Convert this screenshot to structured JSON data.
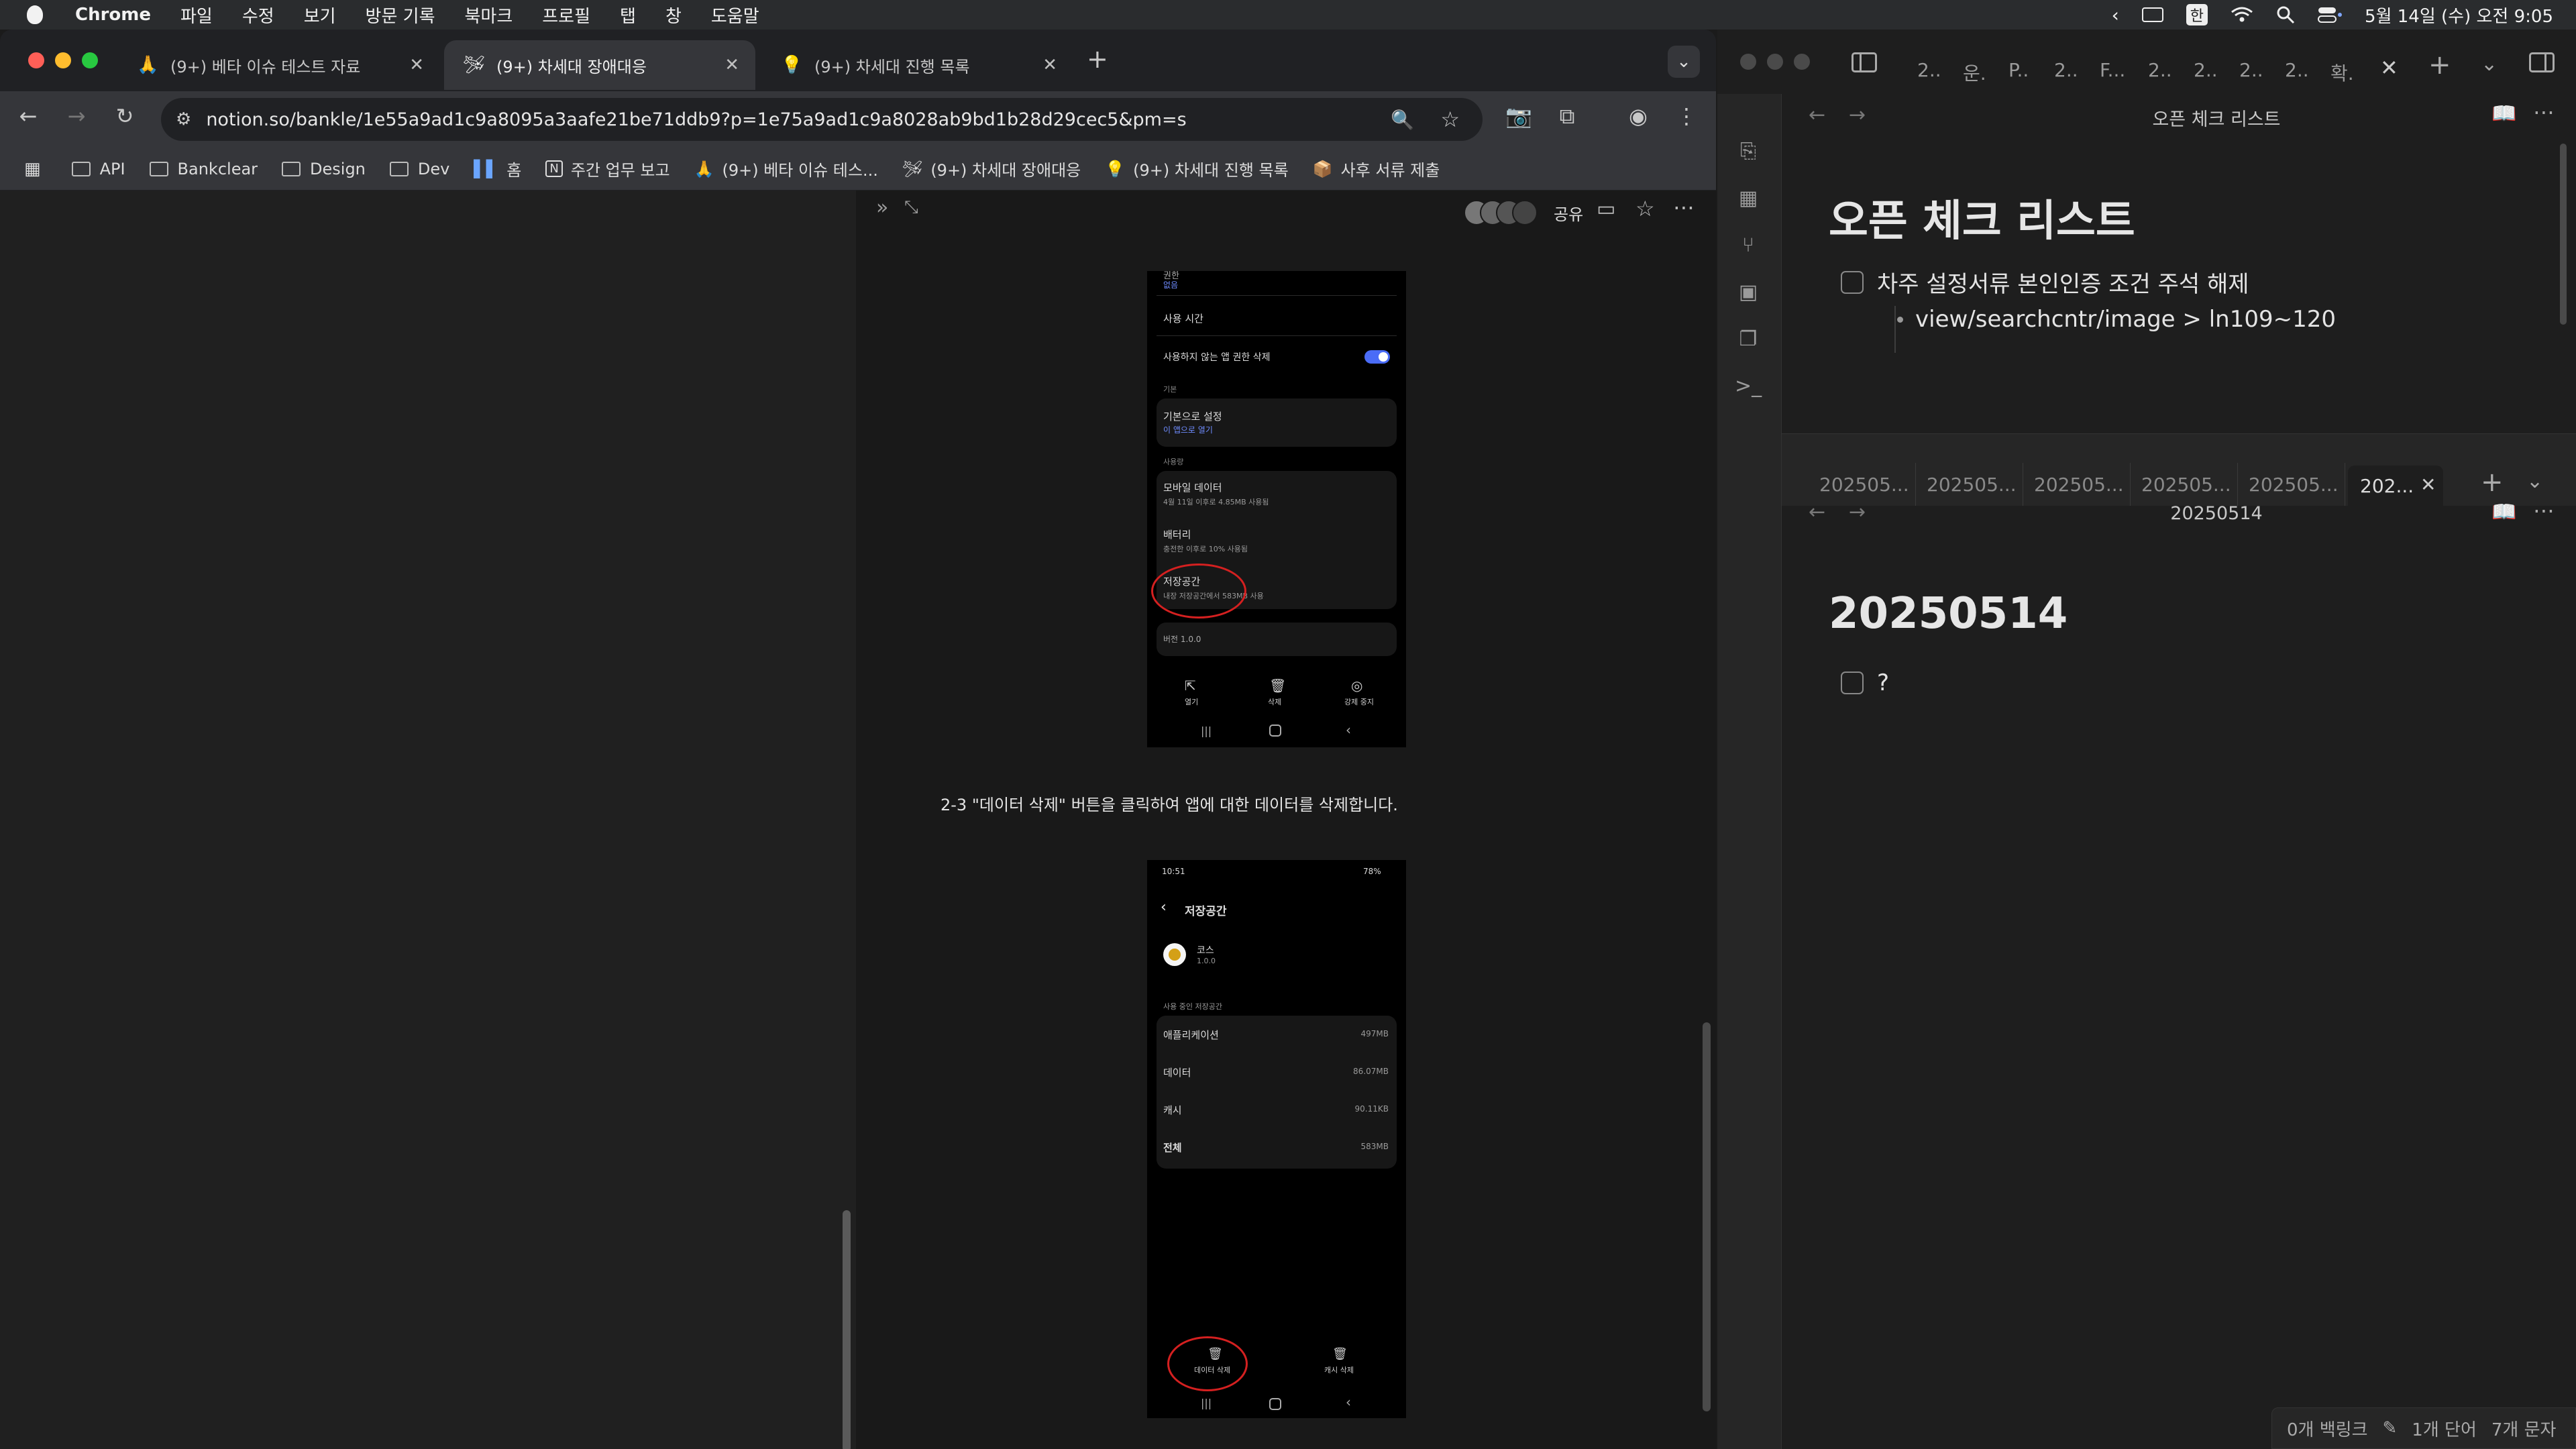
{
  "menubar": {
    "app": "Chrome",
    "items": [
      "파일",
      "수정",
      "보기",
      "방문 기록",
      "북마크",
      "프로필",
      "탭",
      "창",
      "도움말"
    ],
    "ime": "한",
    "datetime": "5월 14일 (수) 오전 9:05"
  },
  "chrome": {
    "tabs": [
      {
        "title": "(9+) 베타 이슈 테스트 자료",
        "icon": "🙏"
      },
      {
        "title": "(9+) 차세대 장애대응",
        "icon": "🛩"
      },
      {
        "title": "(9+) 차세대 진행 목록",
        "icon": "💡"
      }
    ],
    "url": "notion.so/bankle/1e55a9ad1c9a8095a3aafe21be71ddb9?p=1e75a9ad1c9a8028ab9bd1b28d29cec5&pm=s",
    "bookmarks": [
      {
        "label": "API",
        "type": "folder"
      },
      {
        "label": "Bankclear",
        "type": "folder"
      },
      {
        "label": "Design",
        "type": "folder"
      },
      {
        "label": "Dev",
        "type": "folder"
      },
      {
        "label": "홈",
        "type": "page"
      },
      {
        "label": "주간 업무 보고",
        "type": "notion"
      },
      {
        "label": "(9+) 베타 이슈 테스...",
        "type": "page"
      },
      {
        "label": "(9+) 차세대 장애대응",
        "type": "page"
      },
      {
        "label": "(9+) 차세대 진행 목록",
        "type": "page"
      },
      {
        "label": "사후 서류 제출",
        "type": "page"
      }
    ]
  },
  "notion": {
    "share_label": "공유",
    "caption": "2-3 \"데이터 삭제\" 버튼을 클릭하여 앱에 대한 데이터를 삭제합니다.",
    "phone1": {
      "top_label": "권한",
      "top_sub": "없음",
      "usage_time": "사용 시간",
      "remove_perm": "사용하지 않는 앱 권한 삭제",
      "section_default": "기본",
      "default_title": "기본으로 설정",
      "default_sub": "이 앱으로 열기",
      "section_usage": "사용량",
      "mobile_data": "모바일 데이터",
      "mobile_data_sub": "4월 11일 이후로 4.85MB 사용됨",
      "battery": "배터리",
      "battery_sub": "충전한 이후로 10% 사용됨",
      "storage": "저장공간",
      "storage_sub": "내장 저장공간에서 583MB 사용",
      "version": "버전 1.0.0",
      "nav_open": "열기",
      "nav_delete": "삭제",
      "nav_force_stop": "강제 중지"
    },
    "phone2": {
      "status_time": "10:51",
      "status_right": "78%",
      "header": "저장공간",
      "app_name": "코스",
      "app_version": "1.0.0",
      "section": "사용 중인 저장공간",
      "rows": [
        {
          "label": "애플리케이션",
          "value": "497MB"
        },
        {
          "label": "데이터",
          "value": "86.07MB"
        },
        {
          "label": "캐시",
          "value": "90.11KB"
        },
        {
          "label": "전체",
          "value": "583MB"
        }
      ],
      "btn_clear_data": "데이터 삭제",
      "btn_clear_cache": "캐시 삭제"
    }
  },
  "obsidian": {
    "tabs": [
      "2..",
      "운.",
      "P..",
      "2..",
      "F...",
      "2..",
      "2..",
      "2..",
      "2..",
      "확."
    ],
    "top_pane": {
      "title": "오픈 체크 리스트",
      "heading": "오픈 체크 리스트",
      "todo": "차주 설정서류 본인인증 조건 주석 해제",
      "bullet": "view/searchcntr/image > ln109~120"
    },
    "pane_tabs": [
      "202505...",
      "202505...",
      "202505...",
      "202505...",
      "202505...",
      "202..."
    ],
    "bottom_pane": {
      "title": "20250514",
      "heading": "20250514",
      "todo": "?"
    },
    "status": {
      "backlinks": "0개 백링크",
      "words": "1개 단어",
      "chars": "7개 문자"
    }
  }
}
